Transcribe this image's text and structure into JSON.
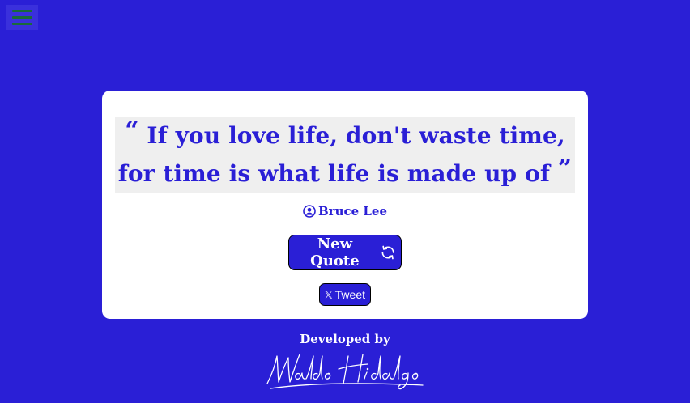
{
  "colors": {
    "background": "#2a1fd6",
    "card": "#ffffff",
    "quote_box": "#efefef",
    "accent": "#2a1fd6",
    "menu_icon": "#1a6a3a"
  },
  "menu": {
    "icon": "hamburger-menu-icon"
  },
  "quote": {
    "open_mark": "“",
    "text": "If you love life, don't waste time, for time is what life is made up of",
    "close_mark": "”"
  },
  "author": {
    "icon": "user-circle-icon",
    "name": "Bruce Lee"
  },
  "buttons": {
    "new_quote_label": "New Quote",
    "new_quote_icon": "refresh-icon",
    "tweet_label": "Tweet",
    "tweet_icon": "x-logo-icon"
  },
  "footer": {
    "developed_by": "Developed by",
    "signature_name": "Waldo Hidalgo"
  }
}
